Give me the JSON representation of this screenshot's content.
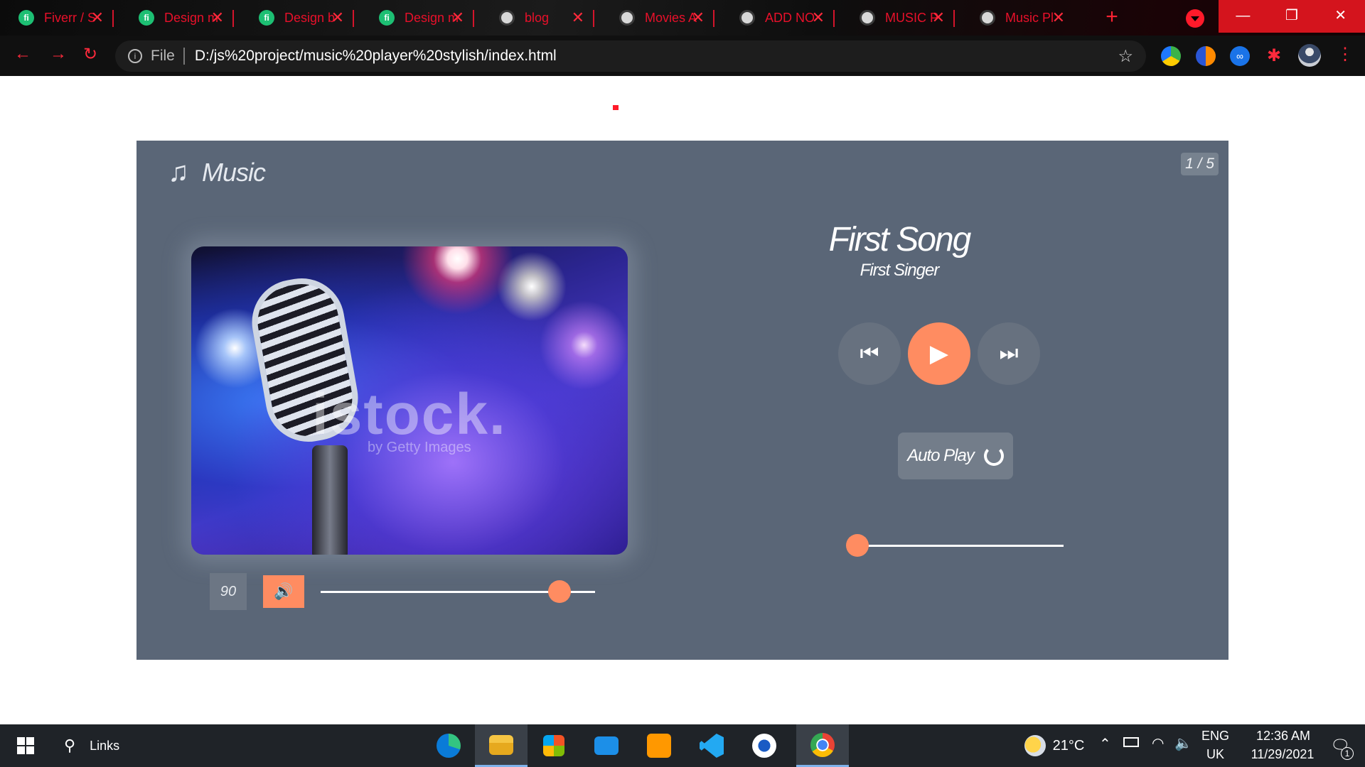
{
  "browser": {
    "tabs": [
      {
        "title": "Fiverr / S",
        "favicon": "fiverr-icon"
      },
      {
        "title": "Design m",
        "favicon": "fiverr-icon"
      },
      {
        "title": "Design b",
        "favicon": "fiverr-icon"
      },
      {
        "title": "Design m",
        "favicon": "fiverr-icon"
      },
      {
        "title": "blog",
        "favicon": "globe-icon"
      },
      {
        "title": "Movies A",
        "favicon": "globe-icon"
      },
      {
        "title": "ADD NO",
        "favicon": "globe-icon"
      },
      {
        "title": "MUSIC P",
        "favicon": "globe-icon"
      },
      {
        "title": "Music Pl",
        "favicon": "globe-icon"
      }
    ],
    "address": {
      "scheme": "File",
      "url": "D:/js%20project/music%20player%20stylish/index.html"
    },
    "accent_color": "#ff1a2a"
  },
  "player": {
    "brand_label": "Music",
    "counter": "1 / 5",
    "song_title": "First Song",
    "artist": "First Singer",
    "art_watermark": "istock.",
    "art_watermark_sub": "by Getty Images",
    "volume_value": "90",
    "volume_level": 0.87,
    "seek_position": 0.0,
    "autoplay_label": "Auto Play",
    "accent_color": "#ff8c61",
    "panel_color": "#5a6677"
  },
  "taskbar": {
    "search_label": "Links",
    "weather": "21°C",
    "language_top": "ENG",
    "language_bottom": "UK",
    "time": "12:36 AM",
    "date": "11/29/2021",
    "notification_count": "1"
  }
}
